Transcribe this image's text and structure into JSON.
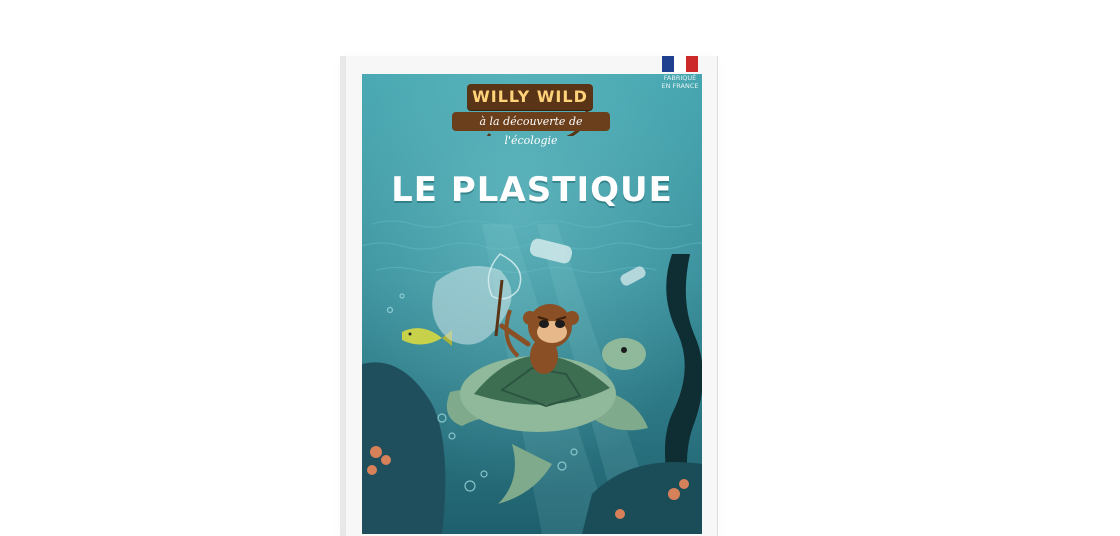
{
  "book": {
    "brand_title": "WILLY WILD",
    "brand_subtitle": "à la découverte de l'écologie",
    "title": "LE PLASTIQUE",
    "origin_label": "FABRIQUÉ\nEN FRANCE"
  },
  "colors": {
    "water_top": "#3c9da8",
    "water_bottom": "#1e5f6f",
    "brand_brown": "#5a3416",
    "brand_gold": "#ffd37a",
    "turtle_green": "#8fb99a",
    "shell_dark": "#3e6e52",
    "flag_blue": "#1f3f8f",
    "flag_white": "#ffffff",
    "flag_red": "#cc2a2a"
  },
  "illustration": {
    "characters": [
      "monkey-icon",
      "sea-turtle-icon",
      "fish-icon"
    ],
    "objects": [
      "plastic-bottle-icon",
      "plastic-bag-icon",
      "fishing-net-icon",
      "seaweed-icon",
      "coral-icon"
    ]
  }
}
